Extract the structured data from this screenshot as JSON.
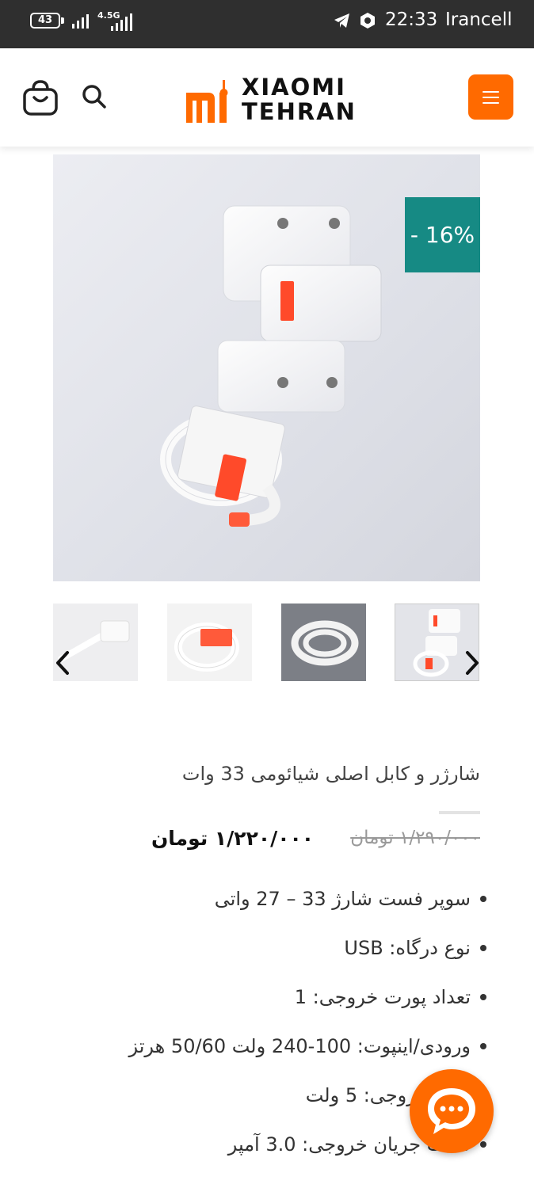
{
  "status_bar": {
    "battery": "43",
    "network": "4.5G",
    "time": "22:33",
    "carrier": "Irancell"
  },
  "header": {
    "logo_line1": "XIAOMI",
    "logo_line2": "TEHRAN",
    "icons": [
      "cart-icon",
      "search-icon",
      "menu-icon"
    ]
  },
  "colors": {
    "brand": "#ff6a00",
    "badge": "#168a84"
  },
  "product": {
    "discount_badge": "- 16%",
    "title": "شارژر و کابل اصلی شیائومی 33 وات",
    "old_price": "۱/۲۹۰/۰۰۰ تومان",
    "new_price": "۱/۲۲۰/۰۰۰ تومان",
    "features": [
      "سوپر فست شارژ 33 – 27 واتی",
      "نوع درگاه: USB",
      "تعداد پورت خروجی: 1",
      "ورودی/اینپوت: 100-240 ولت 50/60 هرتز",
      "ولتاژ خروجی: 5 ولت",
      "شدت جریان خروجی: 3.0 آمپر"
    ]
  },
  "gallery": {
    "thumbnail_count": 4
  }
}
